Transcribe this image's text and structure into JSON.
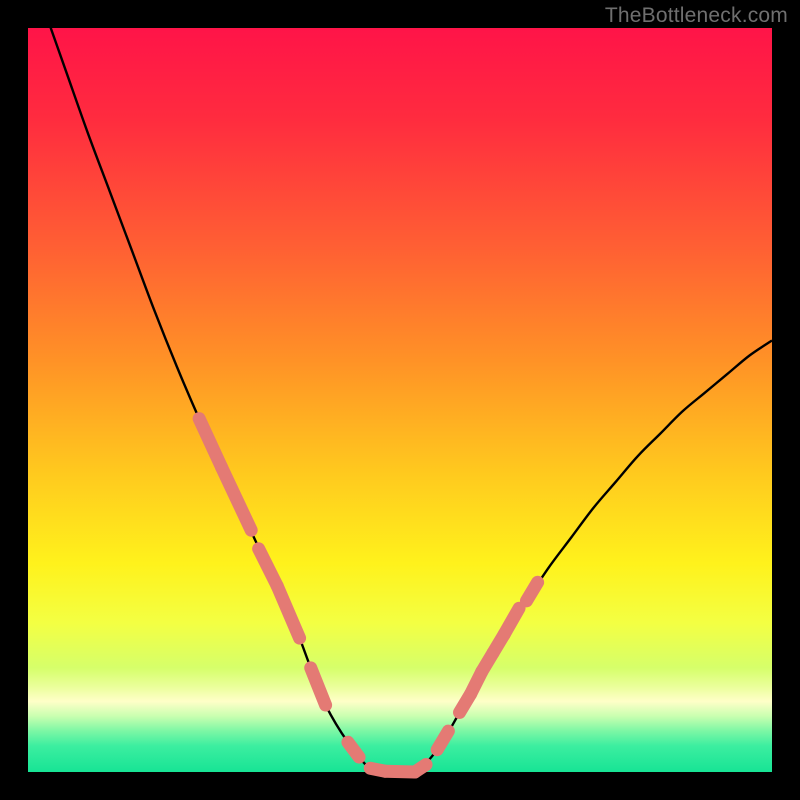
{
  "credit": "TheBottleneck.com",
  "frame": {
    "outer": 800,
    "border": 28,
    "inner_x": 28,
    "inner_y": 28,
    "inner_w": 744,
    "inner_h": 744
  },
  "chart_data": {
    "type": "line",
    "title": "",
    "xlabel": "",
    "ylabel": "",
    "xlim": [
      0,
      100
    ],
    "ylim": [
      0,
      100
    ],
    "x": [
      2,
      5,
      8,
      11,
      14,
      17,
      20,
      23,
      26,
      29,
      32,
      33.5,
      35,
      36.5,
      38,
      40,
      43,
      46,
      49,
      52,
      55,
      58,
      61,
      64,
      67,
      70,
      73,
      76,
      79,
      82,
      85,
      88,
      91,
      94,
      97,
      100
    ],
    "y": [
      103,
      94.5,
      86,
      78,
      70,
      62,
      54.5,
      47.5,
      41,
      34.5,
      28,
      25,
      21.5,
      18,
      14,
      9,
      4,
      0.5,
      0,
      0,
      3,
      8,
      13.5,
      18.5,
      23,
      27.5,
      31.5,
      35.5,
      39,
      42.5,
      45.5,
      48.5,
      51,
      53.5,
      56,
      58
    ],
    "highlight_segments": [
      {
        "x0": 23,
        "y0": 47.5,
        "x1": 26,
        "y1": 41
      },
      {
        "x0": 26,
        "y0": 41,
        "x1": 30,
        "y1": 32.5
      },
      {
        "x0": 31,
        "y0": 30,
        "x1": 33.5,
        "y1": 25
      },
      {
        "x0": 33.5,
        "y0": 25,
        "x1": 36.5,
        "y1": 18
      },
      {
        "x0": 38,
        "y0": 14,
        "x1": 40,
        "y1": 9
      },
      {
        "x0": 43,
        "y0": 4,
        "x1": 44.5,
        "y1": 2
      },
      {
        "x0": 46,
        "y0": 0.5,
        "x1": 48,
        "y1": 0.1
      },
      {
        "x0": 48,
        "y0": 0.1,
        "x1": 52,
        "y1": 0
      },
      {
        "x0": 52,
        "y0": 0,
        "x1": 53.5,
        "y1": 1
      },
      {
        "x0": 55,
        "y0": 3,
        "x1": 56.5,
        "y1": 5.5
      },
      {
        "x0": 58,
        "y0": 8,
        "x1": 59.5,
        "y1": 10.5
      },
      {
        "x0": 59.5,
        "y0": 10.5,
        "x1": 61,
        "y1": 13.5
      },
      {
        "x0": 61,
        "y0": 13.5,
        "x1": 62.5,
        "y1": 16
      },
      {
        "x0": 62.5,
        "y0": 16,
        "x1": 64,
        "y1": 18.5
      },
      {
        "x0": 64,
        "y0": 18.5,
        "x1": 66,
        "y1": 22
      },
      {
        "x0": 67,
        "y0": 23,
        "x1": 68.5,
        "y1": 25.5
      }
    ],
    "gradient_stops": [
      {
        "offset": 0.0,
        "color": "#ff1448"
      },
      {
        "offset": 0.12,
        "color": "#ff2b3f"
      },
      {
        "offset": 0.3,
        "color": "#ff6133"
      },
      {
        "offset": 0.45,
        "color": "#ff9326"
      },
      {
        "offset": 0.6,
        "color": "#ffca1e"
      },
      {
        "offset": 0.72,
        "color": "#fff21c"
      },
      {
        "offset": 0.8,
        "color": "#f3ff43"
      },
      {
        "offset": 0.86,
        "color": "#d6ff6a"
      },
      {
        "offset": 0.885,
        "color": "#eaff9a"
      },
      {
        "offset": 0.905,
        "color": "#ffffc8"
      },
      {
        "offset": 0.925,
        "color": "#c9ffb0"
      },
      {
        "offset": 0.945,
        "color": "#7cf7a5"
      },
      {
        "offset": 0.965,
        "color": "#3ceea0"
      },
      {
        "offset": 1.0,
        "color": "#17e495"
      }
    ],
    "curve_stroke": "#000000",
    "highlight_stroke": "#e47a74"
  }
}
